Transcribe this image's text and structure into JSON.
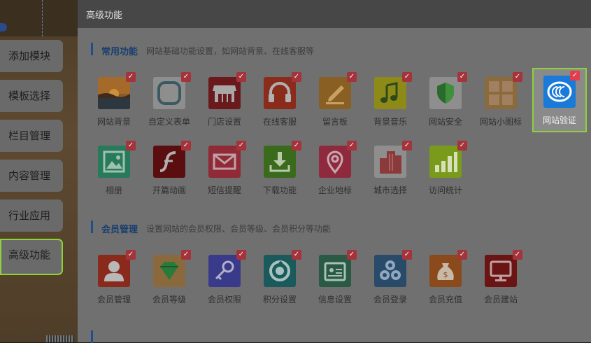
{
  "side_menu": [
    {
      "label": "添加模块",
      "active": false
    },
    {
      "label": "模板选择",
      "active": false
    },
    {
      "label": "栏目管理",
      "active": false
    },
    {
      "label": "内容管理",
      "active": false
    },
    {
      "label": "行业应用",
      "active": false
    },
    {
      "label": "高级功能",
      "active": true
    }
  ],
  "modal": {
    "title": "高级功能",
    "sections": [
      {
        "title": "常用功能",
        "desc": "网站基础功能设置，如网站背景、在线客服等",
        "items": [
          {
            "label": "网站背景",
            "icon": "landscape-icon"
          },
          {
            "label": "自定义表单",
            "icon": "rounded-square-icon"
          },
          {
            "label": "门店设置",
            "icon": "storefront-icon"
          },
          {
            "label": "在线客服",
            "icon": "headset-icon"
          },
          {
            "label": "留言板",
            "icon": "pencil-note-icon"
          },
          {
            "label": "背景音乐",
            "icon": "music-note-icon"
          },
          {
            "label": "网站安全",
            "icon": "shield-icon"
          },
          {
            "label": "网站小图标",
            "icon": "icon-grid-icon"
          },
          {
            "label": "网站验证",
            "icon": "verify-badge-icon"
          },
          {
            "label": "相册",
            "icon": "photo-album-icon"
          },
          {
            "label": "开篇动画",
            "icon": "flash-icon"
          },
          {
            "label": "短信提醒",
            "icon": "envelope-icon"
          },
          {
            "label": "下载功能",
            "icon": "download-icon"
          },
          {
            "label": "企业地标",
            "icon": "map-pin-icon"
          },
          {
            "label": "城市选择",
            "icon": "buildings-icon"
          },
          {
            "label": "访问统计",
            "icon": "bar-stats-icon"
          }
        ]
      },
      {
        "title": "会员管理",
        "desc": "设置网站的会员权限、会员等级、会员积分等功能",
        "items": [
          {
            "label": "会员管理",
            "icon": "user-icon"
          },
          {
            "label": "会员等级",
            "icon": "diamond-icon"
          },
          {
            "label": "会员权限",
            "icon": "key-icon"
          },
          {
            "label": "积分设置",
            "icon": "points-ring-icon"
          },
          {
            "label": "信息设置",
            "icon": "id-card-icon"
          },
          {
            "label": "会员登录",
            "icon": "social-login-icon"
          },
          {
            "label": "会员充值",
            "icon": "money-bag-icon"
          },
          {
            "label": "会员建站",
            "icon": "monitor-icon"
          }
        ]
      }
    ]
  },
  "check_mark": "✓",
  "colors": {
    "accent_green": "#8ed23a",
    "check_red": "#a5333b",
    "title_blue": "#193e6e"
  }
}
